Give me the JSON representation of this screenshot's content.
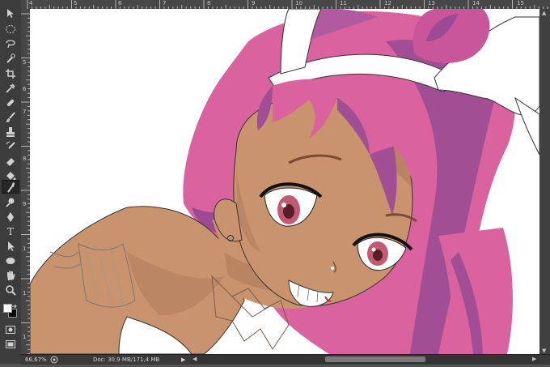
{
  "toolbar": {
    "tools": [
      {
        "name": "move-tool-icon"
      },
      {
        "name": "marquee-tool-icon"
      },
      {
        "name": "lasso-tool-icon"
      },
      {
        "name": "quick-selection-tool-icon"
      },
      {
        "name": "crop-tool-icon"
      },
      {
        "name": "eyedropper-tool-icon"
      },
      {
        "name": "spot-healing-tool-icon"
      },
      {
        "name": "brush-tool-icon"
      },
      {
        "name": "clone-stamp-tool-icon"
      },
      {
        "name": "history-brush-tool-icon"
      },
      {
        "name": "eraser-tool-icon"
      },
      {
        "name": "paint-bucket-tool-icon"
      },
      {
        "name": "smudge-tool-icon",
        "active": true
      },
      {
        "name": "dodge-tool-icon"
      },
      {
        "name": "pen-tool-icon"
      },
      {
        "name": "type-tool-icon",
        "glyph": "T"
      },
      {
        "name": "path-selection-tool-icon"
      },
      {
        "name": "ellipse-tool-icon"
      },
      {
        "name": "hand-tool-icon"
      },
      {
        "name": "zoom-tool-icon"
      }
    ],
    "foreground_color": "#ffffff",
    "background_color": "#000000"
  },
  "rulers": {
    "top_labels": [
      "4",
      "5",
      "6",
      "7",
      "8",
      "9",
      "10",
      "11",
      "12",
      "13",
      "14",
      "15"
    ],
    "left_labels": [
      "5",
      "6",
      "7",
      "8",
      "9",
      "1",
      "1",
      "1"
    ]
  },
  "status": {
    "zoom": "66,67%",
    "doc_info": "Doc: 30,9 MB/171,4 MB"
  },
  "colors": {
    "hair": "#d9629f",
    "hair_shadow": "#9c4a93",
    "skin": "#c9946d",
    "skin_shadow": "#b37d5d",
    "eyes": "#c45a72"
  }
}
